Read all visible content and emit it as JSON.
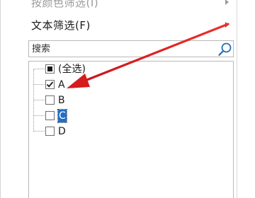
{
  "menu": {
    "filter_by_color": "按颜色筛选(I)",
    "text_filter": "文本筛选(F)"
  },
  "search": {
    "placeholder": "搜索"
  },
  "list": {
    "items": [
      {
        "label": "(全选)",
        "state": "indeterminate"
      },
      {
        "label": "A",
        "state": "checked"
      },
      {
        "label": "B",
        "state": "unchecked"
      },
      {
        "label": "C",
        "state": "unchecked",
        "highlighted": true
      },
      {
        "label": "D",
        "state": "unchecked"
      }
    ]
  },
  "colors": {
    "annotation_arrow": "#e8231f",
    "selection": "#1e6fc7",
    "search_icon": "#2d6eb8"
  },
  "icons": {
    "search": "search-icon",
    "submenu": "chevron-right-icon",
    "annotation": "red-arrow-icon"
  }
}
